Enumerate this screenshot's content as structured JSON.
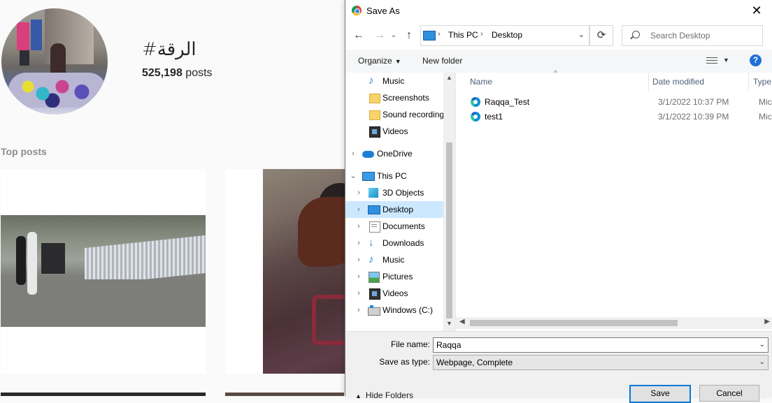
{
  "background": {
    "hashtag": "#الرقة",
    "posts_count_number": "525,198",
    "posts_count_suffix": "posts",
    "top_posts_label": "Top posts"
  },
  "dialog": {
    "title": "Save As",
    "close_glyph": "✕",
    "nav": {
      "back": "←",
      "forward": "→",
      "recent": "⌄",
      "up": "↑",
      "refresh": "⟳"
    },
    "address": {
      "segments": [
        "This PC",
        "Desktop"
      ],
      "separator": "›"
    },
    "search_placeholder": "Search Desktop",
    "toolbar": {
      "organize": "Organize",
      "new_folder": "New folder",
      "help": "?"
    },
    "sidebar": {
      "items": [
        {
          "label": "Music",
          "icon": "music-icon",
          "indent": 2
        },
        {
          "label": "Screenshots",
          "icon": "folder-icon",
          "indent": 2
        },
        {
          "label": "Sound recording",
          "icon": "folder-icon",
          "indent": 2
        },
        {
          "label": "Videos",
          "icon": "videos-icon",
          "indent": 2
        },
        {
          "label": "OneDrive",
          "icon": "cloud-icon",
          "indent": 1,
          "chevron": "›"
        },
        {
          "label": "This PC",
          "icon": "computer-icon",
          "indent": 1,
          "chevron": "⌄"
        },
        {
          "label": "3D Objects",
          "icon": "3d-objects-icon",
          "indent": 2,
          "chevron": "›"
        },
        {
          "label": "Desktop",
          "icon": "desktop-icon",
          "indent": 2,
          "chevron": "›",
          "selected": true
        },
        {
          "label": "Documents",
          "icon": "documents-icon",
          "indent": 2,
          "chevron": "›"
        },
        {
          "label": "Downloads",
          "icon": "downloads-icon",
          "indent": 2,
          "chevron": "›"
        },
        {
          "label": "Music",
          "icon": "music-icon",
          "indent": 2,
          "chevron": "›"
        },
        {
          "label": "Pictures",
          "icon": "pictures-icon",
          "indent": 2,
          "chevron": "›"
        },
        {
          "label": "Videos",
          "icon": "videos-icon",
          "indent": 2,
          "chevron": "›"
        },
        {
          "label": "Windows (C:)",
          "icon": "drive-icon",
          "indent": 2,
          "chevron": "›"
        }
      ]
    },
    "columns": {
      "name": "Name",
      "date_modified": "Date modified",
      "type": "Type"
    },
    "files": [
      {
        "name": "Raqqa_Test",
        "date": "3/1/2022 10:37 PM",
        "type": "Micro"
      },
      {
        "name": "test1",
        "date": "3/1/2022 10:39 PM",
        "type": "Micro"
      }
    ],
    "form": {
      "file_name_label": "File name:",
      "file_name_value": "Raqqa",
      "save_type_label": "Save as type:",
      "save_type_value": "Webpage, Complete",
      "hide_folders": "Hide Folders",
      "save_button": "Save",
      "cancel_button": "Cancel"
    }
  }
}
